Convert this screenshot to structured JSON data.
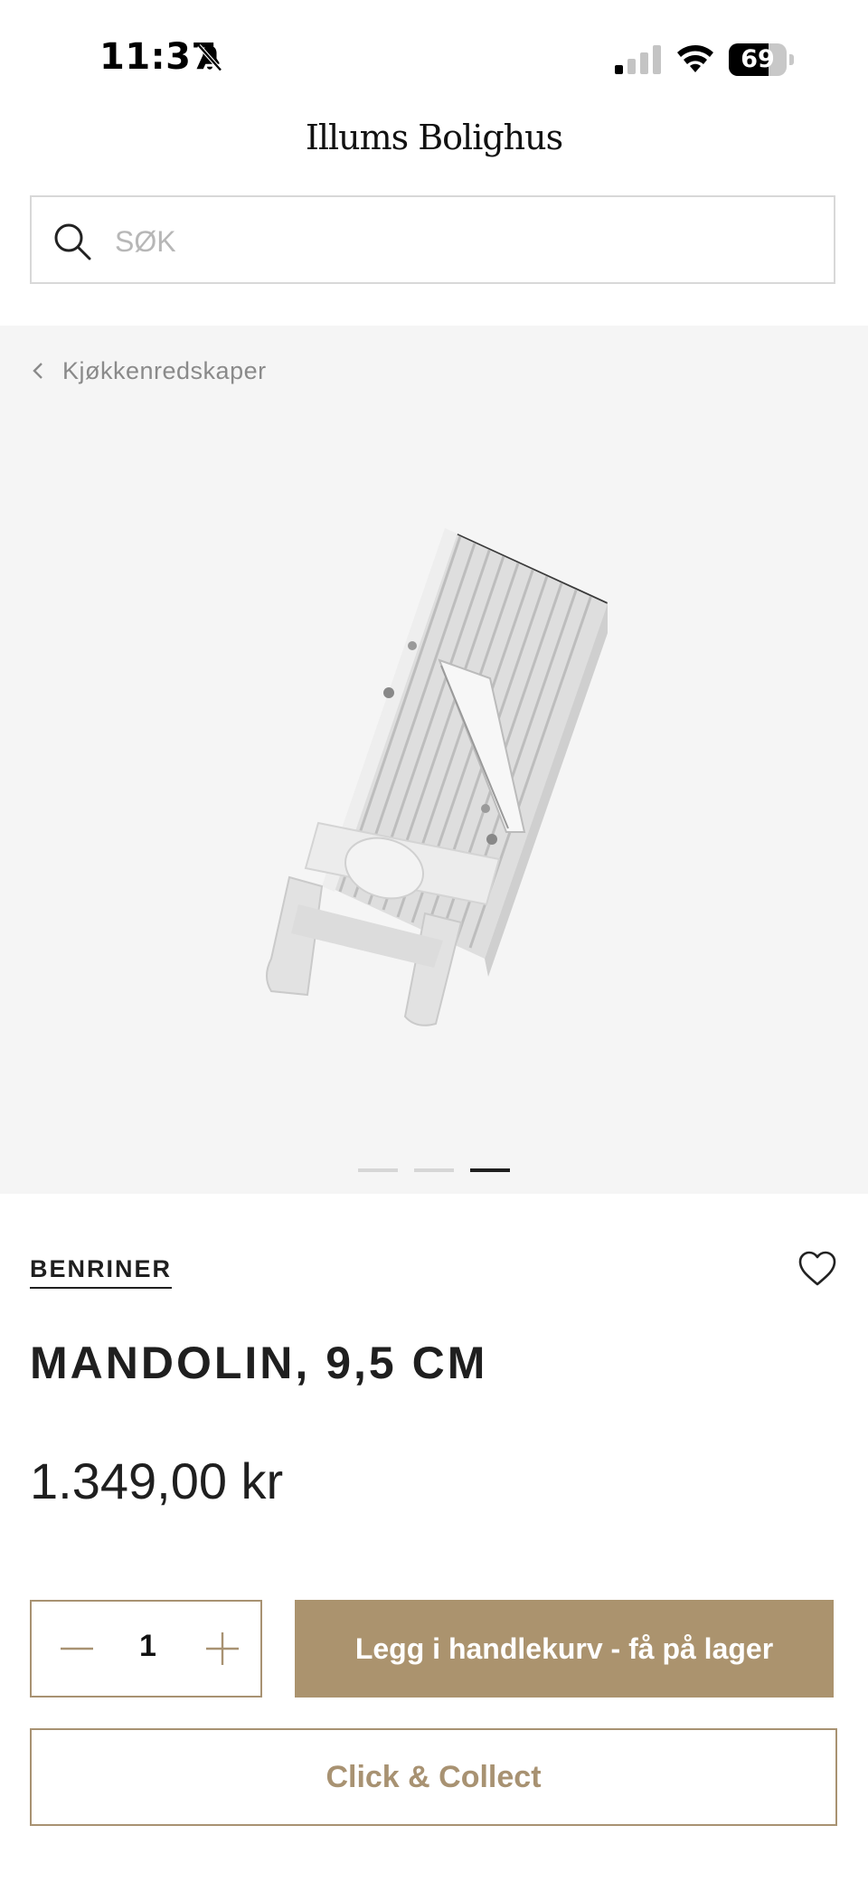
{
  "status_bar": {
    "time": "11:37",
    "battery": "69",
    "battery_level": 0.69
  },
  "header": {
    "logo": "Illums Bolighus"
  },
  "search": {
    "placeholder": "SØK"
  },
  "gallery": {
    "breadcrumb": "Kjøkkenredskaper",
    "image_count": 3,
    "active_index": 2
  },
  "product": {
    "brand": "BENRINER",
    "title": "MANDOLIN, 9,5 CM",
    "price": "1.349,00 kr"
  },
  "actions": {
    "quantity": "1",
    "add_to_cart_label": "Legg i handlekurv - få på lager",
    "click_collect_label": "Click & Collect"
  },
  "colors": {
    "accent": "#ab936e",
    "background": "#ffffff",
    "gallery_bg": "#f5f5f5",
    "text": "#1f1f1f"
  },
  "icons": [
    "bell-slash-icon",
    "signal-icon",
    "wifi-icon",
    "battery-icon",
    "search-icon",
    "chevron-left-icon",
    "heart-icon",
    "minus-icon",
    "plus-icon"
  ]
}
